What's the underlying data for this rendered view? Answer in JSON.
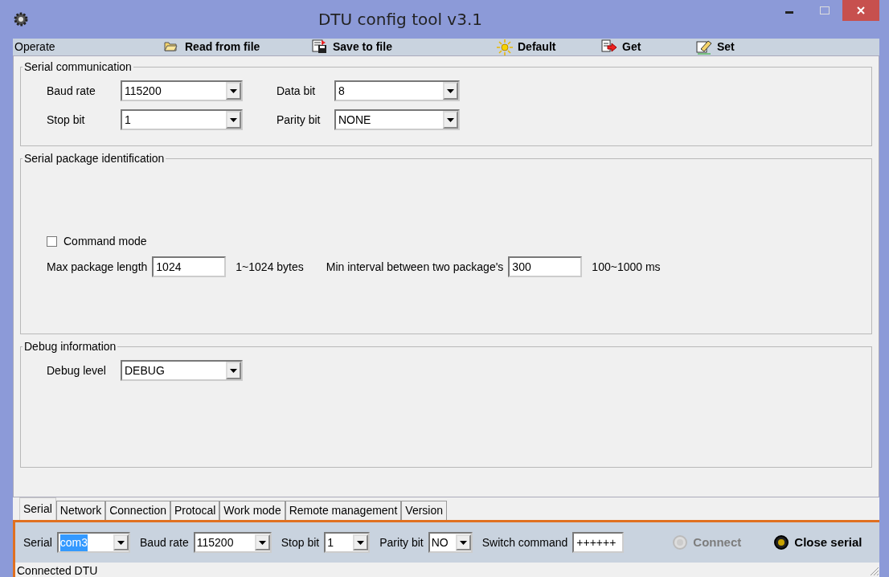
{
  "window": {
    "title": "DTU config tool v3.1"
  },
  "toolbar": {
    "label": "Operate",
    "buttons": [
      {
        "label": "Read from file",
        "kind": "open"
      },
      {
        "label": "Save to file",
        "kind": "save"
      },
      {
        "label": "Default",
        "kind": "default"
      },
      {
        "label": "Get",
        "kind": "get"
      },
      {
        "label": "Set",
        "kind": "set"
      }
    ]
  },
  "sections": [
    {
      "title": "Serial communication",
      "kind": "grid",
      "fields": [
        {
          "label": "Baud rate",
          "value": "115200"
        },
        {
          "label": "Data bit",
          "value": "8"
        },
        {
          "label": "Stop bit",
          "value": "1"
        },
        {
          "label": "Parity bit",
          "value": "NONE"
        }
      ]
    },
    {
      "title": "Serial package identification",
      "kind": "package",
      "checkbox": {
        "label": "Command mode",
        "checked": false
      },
      "fields": [
        {
          "label": "Max package length",
          "value": "1024",
          "hint": "1~1024 bytes"
        },
        {
          "label": "Min interval between two package's",
          "value": "300",
          "hint": "100~1000 ms"
        }
      ]
    },
    {
      "title": "Debug information",
      "kind": "grid",
      "fields": [
        {
          "label": "Debug level",
          "value": "DEBUG"
        }
      ]
    }
  ],
  "tabs": [
    {
      "label": "Serial",
      "selected": true
    },
    {
      "label": "Network",
      "selected": false
    },
    {
      "label": "Connection",
      "selected": false
    },
    {
      "label": "Protocal",
      "selected": false
    },
    {
      "label": "Work mode",
      "selected": false
    },
    {
      "label": "Remote management",
      "selected": false
    },
    {
      "label": "Version",
      "selected": false
    }
  ],
  "connection_bar": {
    "fields": [
      {
        "label": "Serial",
        "value": "com3",
        "kind": "select",
        "highlighted": true
      },
      {
        "label": "Baud rate",
        "value": "115200",
        "kind": "select",
        "highlighted": false
      },
      {
        "label": "Stop bit",
        "value": "1",
        "kind": "select",
        "highlighted": false
      },
      {
        "label": "Parity bit",
        "value": "NO",
        "kind": "select",
        "highlighted": false
      },
      {
        "label": "Switch command",
        "value": "++++++",
        "kind": "input",
        "highlighted": false
      }
    ],
    "buttons": [
      {
        "label": "Connect",
        "disabled": true
      },
      {
        "label": "Close serial",
        "disabled": false
      }
    ]
  },
  "status_bar": "Connected DTU"
}
